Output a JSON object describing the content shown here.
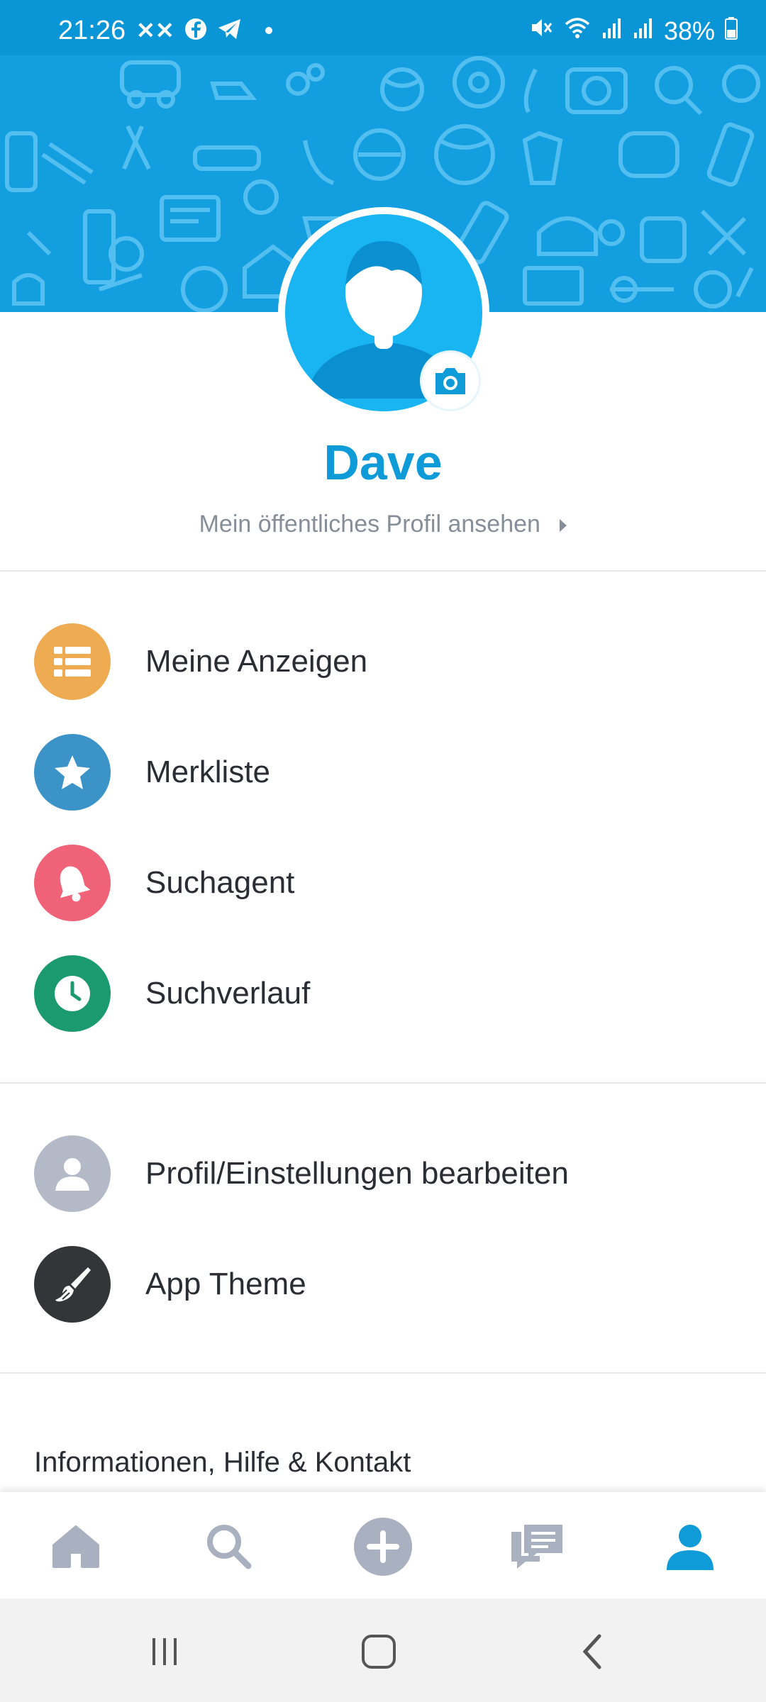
{
  "status_bar": {
    "time": "21:26",
    "battery": "38%",
    "left_icons": [
      "xx-icon",
      "facebook-icon",
      "telegram-icon",
      "dot-icon"
    ],
    "right_icons": [
      "mute-icon",
      "wifi-icon",
      "signal-icon",
      "signal-icon",
      "battery-icon"
    ]
  },
  "profile": {
    "name": "Dave",
    "public_profile_link": "Mein öffentliches Profil ansehen"
  },
  "menu": {
    "section1": [
      {
        "label": "Meine Anzeigen",
        "icon": "list-icon",
        "color": "#eeab51"
      },
      {
        "label": "Merkliste",
        "icon": "star-icon",
        "color": "#3b93c7"
      },
      {
        "label": "Suchagent",
        "icon": "bell-icon",
        "color": "#ef6277"
      },
      {
        "label": "Suchverlauf",
        "icon": "clock-icon",
        "color": "#1c9a6f"
      }
    ],
    "section2": [
      {
        "label": "Profil/Einstellungen bearbeiten",
        "icon": "person-icon",
        "color": "#b3b9c7"
      },
      {
        "label": "App Theme",
        "icon": "paintbrush-icon",
        "color": "#333538"
      }
    ]
  },
  "info_section_title": "Informationen, Hilfe & Kontakt",
  "colors": {
    "accent": "#0f9ad8",
    "status_bar": "#0a96d6",
    "nav_inactive": "#a9b0c0",
    "nav_active": "#0f9ad8"
  },
  "bottom_nav": [
    {
      "name": "home",
      "icon": "home-icon",
      "active": false
    },
    {
      "name": "search",
      "icon": "search-icon",
      "active": false
    },
    {
      "name": "post",
      "icon": "add-circle-icon",
      "active": false
    },
    {
      "name": "messages",
      "icon": "chat-icon",
      "active": false
    },
    {
      "name": "profile",
      "icon": "person-icon",
      "active": true
    }
  ]
}
